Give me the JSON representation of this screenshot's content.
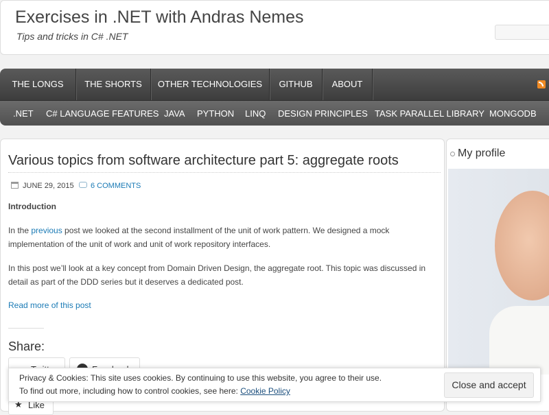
{
  "header": {
    "site_title": "Exercises in .NET with Andras Nemes",
    "site_description": "Tips and tricks in C# .NET"
  },
  "nav": {
    "primary": [
      "THE LONGS",
      "THE SHORTS",
      "OTHER TECHNOLOGIES",
      "GITHUB",
      "ABOUT"
    ],
    "secondary": [
      ".NET",
      "C# LANGUAGE FEATURES",
      "JAVA",
      "PYTHON",
      "LINQ",
      "DESIGN PRINCIPLES",
      "TASK PARALLEL LIBRARY",
      "MONGODB"
    ]
  },
  "post": {
    "title": "Various topics from software architecture part 5: aggregate roots",
    "date": "JUNE 29, 2015",
    "comments": "6 COMMENTS",
    "section_heading": "Introduction",
    "para1_prefix": "In the ",
    "para1_link": "previous",
    "para1_rest": " post we looked at the second installment of the unit of work pattern. We designed a mock implementation of the unit of work and unit of work repository interfaces.",
    "para2": "In this post we’ll look at a key concept from Domain Driven Design, the aggregate root. This topic was discussed in detail as part of the DDD series but it deserves a dedicated post.",
    "read_more": "Read more of this post",
    "share_heading": "Share:",
    "share_buttons": [
      "Twitter",
      "Facebook"
    ],
    "like_label": "Like"
  },
  "sidebar": {
    "widget_title": "My profile"
  },
  "cookie_banner": {
    "line1": "Privacy & Cookies: This site uses cookies. By continuing to use this website, you agree to their use.",
    "line2_prefix": "To find out more, including how to control cookies, see here: ",
    "line2_link": "Cookie Policy",
    "accept_label": "Close and accept"
  }
}
